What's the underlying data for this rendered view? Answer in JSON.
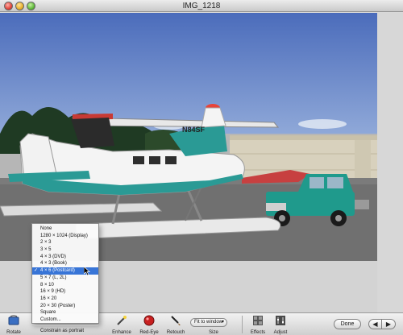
{
  "window": {
    "title": "IMG_1218"
  },
  "photo": {
    "aircraft_registration": "N84SF"
  },
  "toolbar": {
    "rotate": "Rotate",
    "enhance": "Enhance",
    "red_eye": "Red-Eye",
    "retouch": "Retouch",
    "size_value": "Fit to window",
    "size_label": "Size",
    "effects": "Effects",
    "adjust": "Adjust",
    "done": "Done",
    "prev_icon": "left-arrow-icon",
    "next_icon": "right-arrow-icon"
  },
  "constrain_menu": {
    "items": [
      {
        "label": "None"
      },
      {
        "label": "1280 × 1024 (Display)"
      },
      {
        "label": "2 × 3"
      },
      {
        "label": "3 × 5"
      },
      {
        "label": "4 × 3 (DVD)"
      },
      {
        "label": "4 × 3 (Book)"
      },
      {
        "label": "4 × 6 (Postcard)",
        "check": "✓",
        "selected": true
      },
      {
        "label": "5 × 7 (L, 2L)"
      },
      {
        "label": "8 × 10"
      },
      {
        "label": "16 × 9 (HD)"
      },
      {
        "label": "16 × 20"
      },
      {
        "label": "20 × 30 (Poster)"
      },
      {
        "label": "Square"
      },
      {
        "label": "Custom..."
      }
    ],
    "footer": "Constrain as portrait"
  },
  "colors": {
    "sky": "#5b79c0",
    "selection": "#3875d7",
    "plane_teal": "#2a9a95",
    "truck_teal": "#1f9a8c"
  }
}
